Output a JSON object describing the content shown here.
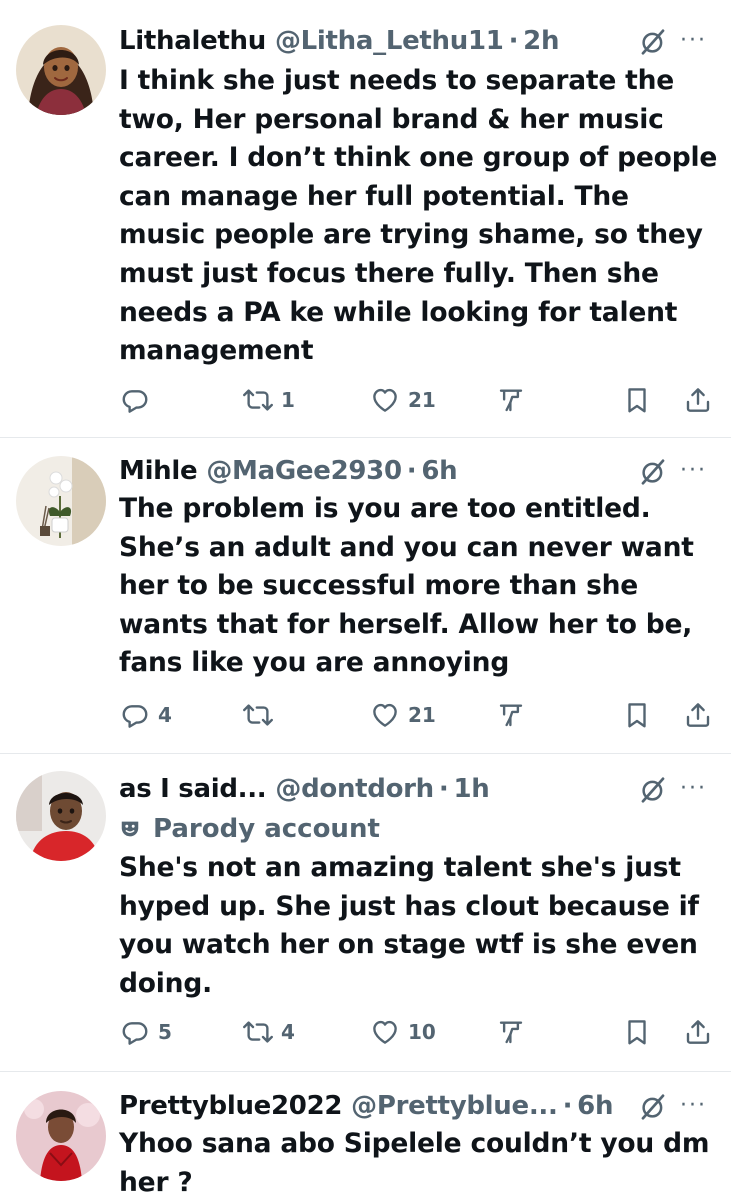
{
  "tweets": [
    {
      "name": "Lithalethu",
      "handle": "@Litha_Lethu11",
      "separator": "·",
      "time": "2h",
      "parody": "",
      "text": "I think she just needs to separate the two, Her personal brand & her music career. I don’t think one group of people can manage her full potential. The music people are trying shame, so they must just focus there fully. Then she needs a PA ke while looking for talent management",
      "replies": "",
      "retweets": "1",
      "likes": "21"
    },
    {
      "name": "Mihle",
      "handle": "@MaGee2930",
      "separator": "·",
      "time": "6h",
      "parody": "",
      "text": "The problem is you are too entitled. She’s an adult and you can never want her to be successful more than she wants that for herself. Allow her to be, fans like you are annoying",
      "replies": "4",
      "retweets": "",
      "likes": "21"
    },
    {
      "name": "as I said...",
      "handle": "@dontdorh",
      "separator": "·",
      "time": "1h",
      "parody": "Parody account",
      "text": "She's not an amazing talent she's just hyped up. She just has clout because if you watch her on stage wtf is she even doing.",
      "replies": "5",
      "retweets": "4",
      "likes": "10"
    },
    {
      "name": "Prettyblue2022",
      "handle": "@Prettyblue...",
      "separator": "·",
      "time": "6h",
      "parody": "",
      "text": "Yhoo sana abo Sipelele couldn’t you dm her ?",
      "replies": "",
      "retweets": "",
      "likes": ""
    }
  ],
  "icons": {
    "reply": "reply-icon",
    "retweet": "retweet-icon",
    "like": "heart-icon",
    "views": "views-chart-icon",
    "bookmark": "bookmark-icon",
    "share": "share-icon",
    "grok": "grok-icon",
    "more": "more-icon",
    "parody": "parody-mask-icon"
  },
  "colors": {
    "text": "#0f1419",
    "secondary": "#536471",
    "divider": "#e6e9ec"
  },
  "more_glyph": "···"
}
